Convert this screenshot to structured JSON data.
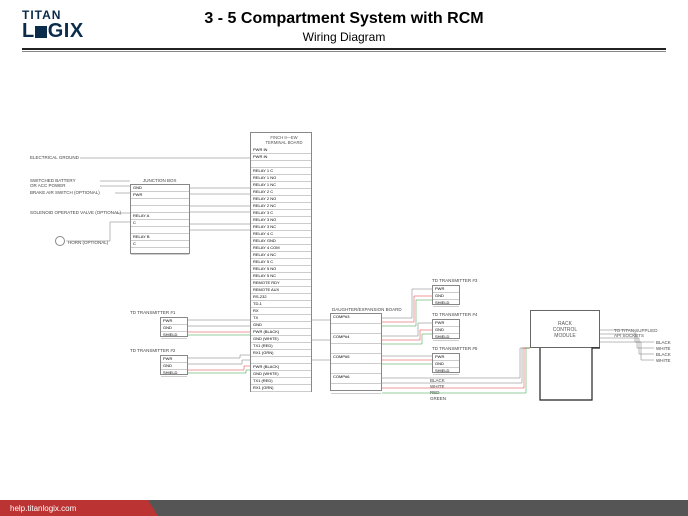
{
  "header": {
    "logo_top": "TITAN",
    "logo_bottom_a": "L",
    "logo_bottom_b": "GIX",
    "title": "3 - 5 Compartment System with RCM",
    "subtitle": "Wiring Diagram"
  },
  "footer": {
    "url": "help.titanlogix.com"
  },
  "labels": {
    "elec_ground": "ELECTRICAL GROUND",
    "sw_batt1": "SWITCHED BATTERY",
    "sw_batt2": "OR ACC POWER",
    "brake_air": "BRAKE AIR SWITCH (OPTIONAL)",
    "solenoid": "SOLENOID OPERATED VALVE (OPTIONAL)",
    "horn": "HORN (OPTIONAL)",
    "junction": "JUNCTION BOX",
    "terminal_board_1": "FINCH II—EW",
    "terminal_board_2": "TERMINAL BOARD",
    "daughter": "DAUGHTER/EXPANSION BOARD",
    "tx1": "TD TRANSMITTER #1",
    "tx2": "TD TRANSMITTER #2",
    "tx3": "TD TRANSMITTER #3",
    "tx4": "TD TRANSMITTER #4",
    "tx5": "TD TRANSMITTER #5",
    "rcm1": "RACK",
    "rcm2": "CONTROL",
    "rcm3": "MODULE",
    "api1": "TO TITAN SUPPLIED",
    "api2": "API SOCKETS",
    "color_black": "BLACK",
    "color_white": "WHITE",
    "color_red": "RED",
    "color_green": "GREEN"
  },
  "tx_ports": [
    "PWR",
    "GND",
    "SHIELD"
  ],
  "terminal_rows": [
    "PWR IN",
    "PWR IN",
    "",
    "RELAY 1 C",
    "RELAY 1 NO",
    "RELAY 1 NC",
    "RELAY 2 C",
    "RELAY 2 NO",
    "RELAY 2 NC",
    "RELAY 3 C",
    "RELAY 3 NO",
    "RELAY 3 NC",
    "RELAY 4 C",
    "RELAY GND",
    "RELAY 4 COM",
    "RELAY 4 NC",
    "RELAY 5 C",
    "RELAY 5 NO",
    "RELAY 5 NC",
    "REMOTE RDY",
    "REMOTE AUX",
    "RS-232",
    "TD-1",
    "RX",
    "TX",
    "GND",
    "PWR (BLACK)",
    "GND (WHITE)",
    "TX1 (RED)",
    "RX1 (GRN)",
    "",
    "PWR (BLACK)",
    "GND (WHITE)",
    "TX1 (RED)",
    "RX1 (GRN)"
  ],
  "daughter_rows": [
    "COMP#3",
    "",
    "COMP#4",
    "",
    "COMP#5",
    "",
    "COMP#6",
    ""
  ],
  "junction_rows": [
    "GND",
    "PWR",
    "",
    "",
    "RELAY A",
    "C",
    "",
    "RELAY B",
    "C",
    ""
  ],
  "chart_data": {
    "type": "table",
    "title": "3 - 5 Compartment System with RCM — Wiring Diagram",
    "components": [
      {
        "id": "electrical-ground",
        "label": "ELECTRICAL GROUND"
      },
      {
        "id": "switched-battery",
        "label": "SWITCHED BATTERY OR ACC POWER"
      },
      {
        "id": "brake-air-switch",
        "label": "BRAKE AIR SWITCH (OPTIONAL)"
      },
      {
        "id": "solenoid-valve",
        "label": "SOLENOID OPERATED VALVE (OPTIONAL)"
      },
      {
        "id": "horn",
        "label": "HORN (OPTIONAL)"
      },
      {
        "id": "junction-box",
        "label": "JUNCTION BOX",
        "ports": [
          "GND",
          "PWR",
          "RELAY A",
          "C",
          "RELAY B",
          "C"
        ]
      },
      {
        "id": "terminal-board",
        "label": "FINCH II—EW TERMINAL BOARD",
        "ports": [
          "PWR IN",
          "PWR IN",
          "RELAY 1 C",
          "RELAY 1 NO",
          "RELAY 1 NC",
          "RELAY 2 C",
          "RELAY 2 NO",
          "RELAY 2 NC",
          "RELAY 3 C",
          "RELAY 3 NO",
          "RELAY 3 NC",
          "RELAY 4 C",
          "RELAY GND",
          "RELAY 4 COM",
          "RELAY 4 NC",
          "RELAY 5 C",
          "RELAY 5 NO",
          "RELAY 5 NC",
          "REMOTE RDY",
          "REMOTE AUX",
          "RS-232",
          "TD-1",
          "RX",
          "TX",
          "GND",
          "PWR (BLACK)",
          "GND (WHITE)",
          "TX1 (RED)",
          "RX1 (GRN)",
          "PWR (BLACK)",
          "GND (WHITE)",
          "TX1 (RED)",
          "RX1 (GRN)"
        ]
      },
      {
        "id": "daughter-board",
        "label": "DAUGHTER/EXPANSION BOARD",
        "ports": [
          "COMP#3",
          "COMP#4",
          "COMP#5",
          "COMP#6"
        ]
      },
      {
        "id": "td-transmitter-1",
        "label": "TD TRANSMITTER #1",
        "ports": [
          "PWR",
          "GND",
          "SHIELD"
        ]
      },
      {
        "id": "td-transmitter-2",
        "label": "TD TRANSMITTER #2",
        "ports": [
          "PWR",
          "GND",
          "SHIELD"
        ]
      },
      {
        "id": "td-transmitter-3",
        "label": "TD TRANSMITTER #3",
        "ports": [
          "PWR",
          "GND",
          "SHIELD"
        ]
      },
      {
        "id": "td-transmitter-4",
        "label": "TD TRANSMITTER #4",
        "ports": [
          "PWR",
          "GND",
          "SHIELD"
        ]
      },
      {
        "id": "td-transmitter-5",
        "label": "TD TRANSMITTER #5",
        "ports": [
          "PWR",
          "GND",
          "SHIELD"
        ]
      },
      {
        "id": "rack-control-module",
        "label": "RACK CONTROL MODULE"
      },
      {
        "id": "api-sockets",
        "label": "TO TITAN SUPPLIED API SOCKETS",
        "wires": [
          "BLACK",
          "WHITE",
          "BLACK",
          "WHITE"
        ]
      }
    ],
    "connections": [
      {
        "from": "electrical-ground",
        "to": "junction-box.GND"
      },
      {
        "from": "switched-battery",
        "to": "junction-box.PWR"
      },
      {
        "from": "brake-air-switch",
        "to": "junction-box"
      },
      {
        "from": "solenoid-valve",
        "to": "junction-box.RELAY A"
      },
      {
        "from": "horn",
        "to": "junction-box.RELAY B"
      },
      {
        "from": "junction-box",
        "to": "terminal-board.PWR IN"
      },
      {
        "from": "junction-box",
        "to": "terminal-board.RELAY 1"
      },
      {
        "from": "junction-box",
        "to": "terminal-board.RELAY 2"
      },
      {
        "from": "td-transmitter-1",
        "to": "terminal-board",
        "wires": [
          "PWR",
          "GND",
          "SHIELD",
          "TX",
          "RX"
        ],
        "colors": [
          "black",
          "white",
          "",
          "red",
          "green"
        ]
      },
      {
        "from": "td-transmitter-2",
        "to": "terminal-board",
        "wires": [
          "PWR",
          "GND",
          "SHIELD",
          "TX",
          "RX"
        ],
        "colors": [
          "black",
          "white",
          "",
          "red",
          "green"
        ]
      },
      {
        "from": "td-transmitter-3",
        "to": "daughter-board.COMP#3",
        "wires": [
          "PWR",
          "GND",
          "SHIELD"
        ],
        "colors": [
          "black",
          "white",
          "red",
          "green"
        ]
      },
      {
        "from": "td-transmitter-4",
        "to": "daughter-board.COMP#4",
        "wires": [
          "PWR",
          "GND",
          "SHIELD"
        ],
        "colors": [
          "black",
          "white",
          "red",
          "green"
        ]
      },
      {
        "from": "td-transmitter-5",
        "to": "daughter-board.COMP#5",
        "wires": [
          "PWR",
          "GND",
          "SHIELD"
        ],
        "colors": [
          "black",
          "white",
          "red",
          "green"
        ]
      },
      {
        "from": "daughter-board.COMP#6",
        "to": "rack-control-module",
        "colors": [
          "black",
          "white",
          "red",
          "green"
        ]
      },
      {
        "from": "rack-control-module",
        "to": "api-sockets",
        "colors": [
          "black",
          "white",
          "black",
          "white"
        ]
      },
      {
        "from": "terminal-board",
        "to": "daughter-board"
      }
    ]
  }
}
